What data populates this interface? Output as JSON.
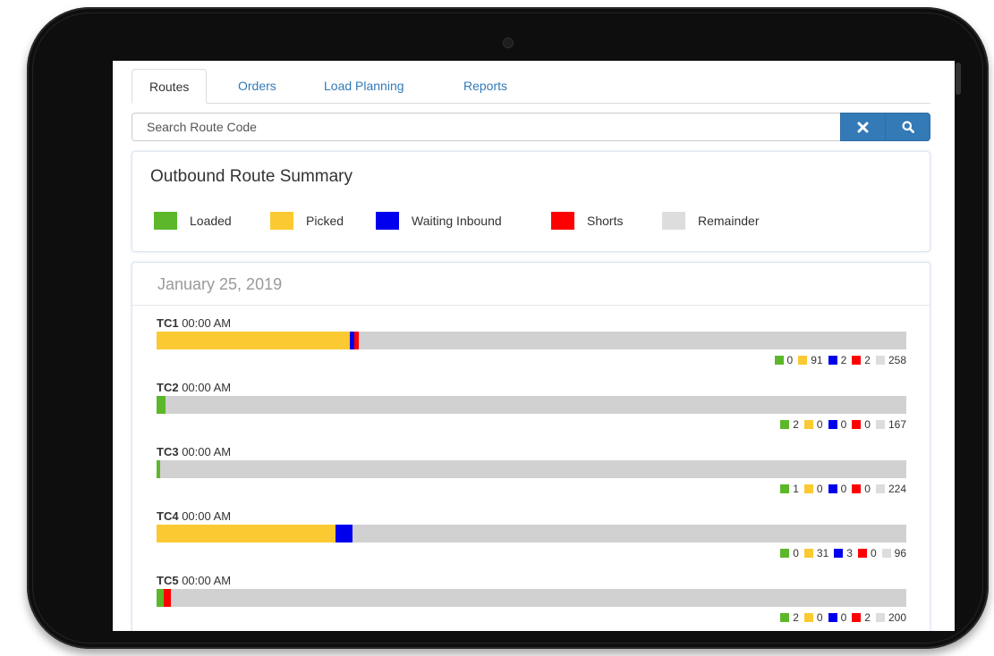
{
  "colors": {
    "loaded": "#5cb82a",
    "picked": "#fbc932",
    "waiting_inbound": "#0000ee",
    "shorts": "#ff0000",
    "remainder": "#d1d1d1",
    "accent": "#337ab7"
  },
  "tabs": [
    {
      "label": "Routes",
      "active": true
    },
    {
      "label": "Orders",
      "active": false
    },
    {
      "label": "Load Planning",
      "active": false
    },
    {
      "label": "Reports",
      "active": false
    }
  ],
  "search": {
    "placeholder": "Search Route Code",
    "value": "",
    "clear_icon": "x-icon",
    "search_icon": "search-icon"
  },
  "summary": {
    "title": "Outbound Route Summary",
    "legend": [
      {
        "key": "loaded",
        "label": "Loaded"
      },
      {
        "key": "picked",
        "label": "Picked"
      },
      {
        "key": "waiting_inbound",
        "label": "Waiting Inbound"
      },
      {
        "key": "shorts",
        "label": "Shorts"
      },
      {
        "key": "remainder",
        "label": "Remainder"
      }
    ]
  },
  "date_label": "January 25, 2019",
  "routes": [
    {
      "code": "TC1",
      "time": "00:00 AM",
      "loaded": 0,
      "picked": 91,
      "waiting_inbound": 2,
      "shorts": 2,
      "remainder": 258
    },
    {
      "code": "TC2",
      "time": "00:00 AM",
      "loaded": 2,
      "picked": 0,
      "waiting_inbound": 0,
      "shorts": 0,
      "remainder": 167
    },
    {
      "code": "TC3",
      "time": "00:00 AM",
      "loaded": 1,
      "picked": 0,
      "waiting_inbound": 0,
      "shorts": 0,
      "remainder": 224
    },
    {
      "code": "TC4",
      "time": "00:00 AM",
      "loaded": 0,
      "picked": 31,
      "waiting_inbound": 3,
      "shorts": 0,
      "remainder": 96
    },
    {
      "code": "TC5",
      "time": "00:00 AM",
      "loaded": 2,
      "picked": 0,
      "waiting_inbound": 0,
      "shorts": 2,
      "remainder": 200
    }
  ]
}
